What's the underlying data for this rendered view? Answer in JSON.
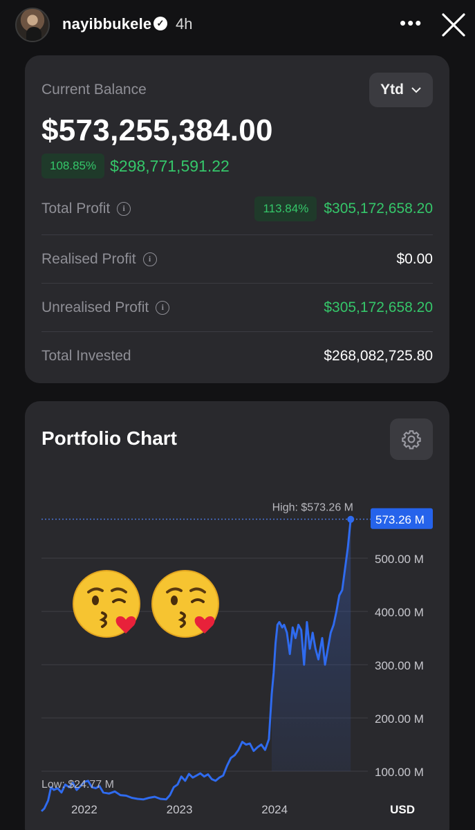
{
  "story": {
    "username": "nayibbukele",
    "verified_icon": "verified-badge-icon",
    "time": "4h"
  },
  "balance": {
    "label": "Current Balance",
    "period": "Ytd",
    "value": "$573,255,384.00",
    "change_pct": "108.85%",
    "change_amount": "$298,771,591.22",
    "rows": [
      {
        "label": "Total Profit",
        "pct": "113.84%",
        "value": "$305,172,658.20",
        "color": "#35c76a"
      },
      {
        "label": "Realised Profit",
        "value": "$0.00",
        "color": "#ffffff"
      },
      {
        "label": "Unrealised Profit",
        "value": "$305,172,658.20",
        "color": "#35c76a"
      },
      {
        "label": "Total Invested",
        "value": "$268,082,725.80",
        "color": "#ffffff"
      }
    ]
  },
  "chart": {
    "title": "Portfolio Chart",
    "high_label": "High: $573.26 M",
    "low_label": "Low: $24.77 M",
    "current_label": "573.26 M",
    "currency": "USD",
    "decorations": [
      "kissing-face-emoji",
      "kissing-face-emoji"
    ]
  },
  "chart_data": {
    "type": "area",
    "ylim": [
      0,
      600
    ],
    "y_ticks": [
      100,
      200,
      300,
      400,
      500
    ],
    "y_tick_labels": [
      "100.00 M",
      "200.00 M",
      "300.00 M",
      "400.00 M",
      "500.00 M"
    ],
    "x_tick_labels": [
      "2022",
      "2023",
      "2024"
    ],
    "x_ticks": [
      2022.0,
      2023.0,
      2024.0
    ],
    "xlim": [
      2021.55,
      2024.82
    ],
    "high": 573.26,
    "low": 24.77,
    "series": [
      {
        "x": [
          2021.55,
          2021.58,
          2021.62,
          2021.65,
          2021.68,
          2021.72,
          2021.76,
          2021.8,
          2021.84,
          2021.88,
          2021.92,
          2021.96,
          2022.0,
          2022.04,
          2022.08,
          2022.12,
          2022.16,
          2022.2,
          2022.26,
          2022.32,
          2022.38,
          2022.44,
          2022.5,
          2022.56,
          2022.62,
          2022.68,
          2022.74,
          2022.8,
          2022.86,
          2022.9,
          2022.94,
          2022.98,
          2023.02,
          2023.06,
          2023.1,
          2023.14,
          2023.18,
          2023.22,
          2023.26,
          2023.3,
          2023.34,
          2023.38,
          2023.42,
          2023.46,
          2023.5,
          2023.54,
          2023.58,
          2023.62,
          2023.66,
          2023.7,
          2023.74,
          2023.78,
          2023.82,
          2023.86,
          2023.9,
          2023.94,
          2023.97,
          2023.99,
          2024.01,
          2024.03,
          2024.05,
          2024.08,
          2024.1,
          2024.13,
          2024.16,
          2024.19,
          2024.22,
          2024.25,
          2024.28,
          2024.31,
          2024.34,
          2024.37,
          2024.4,
          2024.43,
          2024.46,
          2024.5,
          2024.53,
          2024.56,
          2024.59,
          2024.62,
          2024.65,
          2024.68,
          2024.71,
          2024.74,
          2024.77,
          2024.8
        ],
        "values": [
          25,
          30,
          45,
          70,
          65,
          68,
          60,
          75,
          70,
          78,
          65,
          72,
          80,
          82,
          70,
          68,
          72,
          60,
          58,
          62,
          55,
          54,
          50,
          48,
          47,
          50,
          52,
          48,
          47,
          55,
          70,
          75,
          90,
          82,
          95,
          88,
          92,
          96,
          90,
          94,
          85,
          82,
          88,
          92,
          110,
          125,
          130,
          140,
          155,
          150,
          152,
          138,
          145,
          150,
          140,
          160,
          245,
          285,
          340,
          375,
          380,
          370,
          375,
          360,
          320,
          370,
          350,
          375,
          365,
          300,
          380,
          330,
          360,
          330,
          310,
          350,
          300,
          330,
          360,
          375,
          400,
          430,
          440,
          480,
          520,
          573
        ]
      }
    ]
  }
}
